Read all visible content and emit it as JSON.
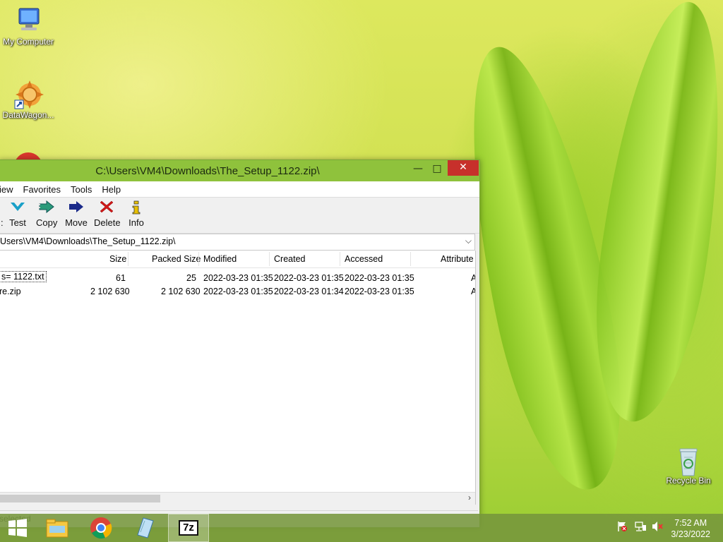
{
  "desktop": {
    "icons": [
      {
        "label": "My Computer",
        "icon": "computer-icon"
      },
      {
        "label": "DataWagon...",
        "icon": "datawagon-icon"
      },
      {
        "label": "Recycle Bin",
        "icon": "recycle-bin-icon"
      }
    ]
  },
  "window": {
    "title": "C:\\Users\\VM4\\Downloads\\The_Setup_1122.zip\\",
    "controls": {
      "minimize": "—",
      "maximize": "□",
      "close": "✕"
    },
    "menu": [
      "iew",
      "Favorites",
      "Tools",
      "Help"
    ],
    "toolbar": [
      {
        "label": "Test",
        "icon": "test-icon",
        "color": "#1aa0c8"
      },
      {
        "label": "Copy",
        "icon": "copy-icon",
        "color": "#2a9a7a"
      },
      {
        "label": "Move",
        "icon": "move-icon",
        "color": "#1a2a8a"
      },
      {
        "label": "Delete",
        "icon": "delete-icon",
        "color": "#d01818"
      },
      {
        "label": "Info",
        "icon": "info-icon",
        "color": "#e8c000"
      }
    ],
    "toolbar_partial_glyph": ":",
    "path": "Users\\VM4\\Downloads\\The_Setup_1122.zip\\",
    "columns": [
      "Size",
      "Packed Size",
      "Modified",
      "Created",
      "Accessed",
      "Attribute"
    ],
    "rows": [
      {
        "name": "s=   1122.txt",
        "size": "61",
        "packed": "25",
        "modified": "2022-03-23 01:35",
        "created": "2022-03-23 01:35",
        "accessed": "2022-03-23 01:35",
        "attr": "A"
      },
      {
        "name": "re.zip",
        "size": "2 102 630",
        "packed": "2 102 630",
        "modified": "2022-03-23 01:35",
        "created": "2022-03-23 01:34",
        "accessed": "2022-03-23 01:35",
        "attr": "A"
      }
    ],
    "status": "selected"
  },
  "taskbar": {
    "clock_time": "7:52 AM",
    "clock_date": "3/23/2022",
    "apps": [
      "start-icon",
      "file-explorer-icon",
      "chrome-icon",
      "notepad-icon",
      "7zip-icon"
    ],
    "active_app_label": "7z"
  },
  "colors": {
    "titlebar": "#8fc23c",
    "close_button": "#c7302b",
    "taskbar": "#76963c"
  }
}
